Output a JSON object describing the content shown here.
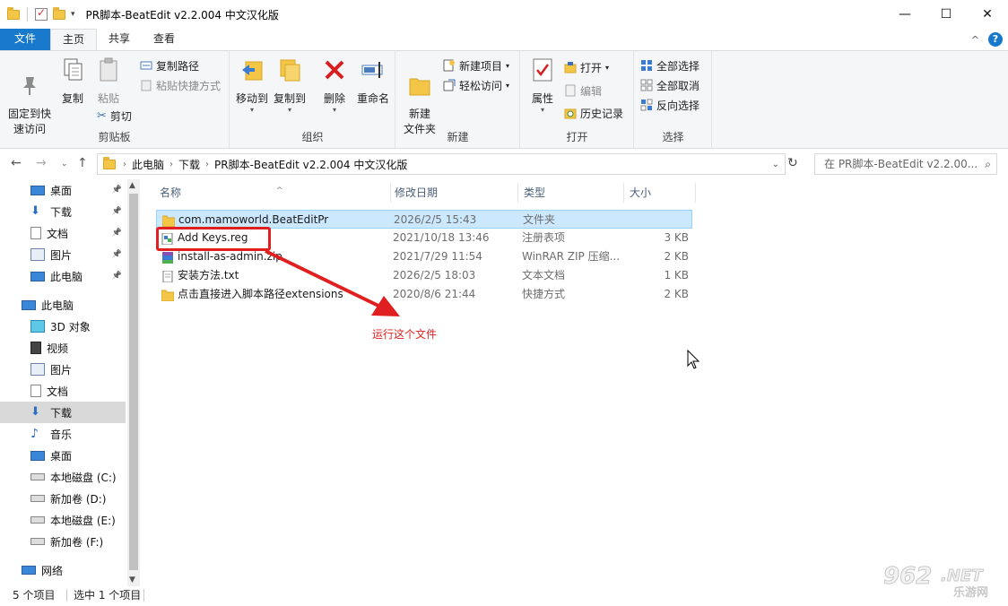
{
  "window": {
    "title": "PR脚本-BeatEdit v2.2.004 中文汉化版",
    "controls": [
      "—",
      "☐",
      "✕"
    ]
  },
  "ribbon_tabs": [
    "文件",
    "主页",
    "共享",
    "查看"
  ],
  "ribbon": {
    "clipboard": {
      "pin": "固定到快\n速访问",
      "copy": "复制",
      "paste": "粘贴",
      "copy_path": "复制路径",
      "paste_shortcut": "粘贴快捷方式",
      "cut": "剪切",
      "label": "剪贴板"
    },
    "organize": {
      "move_to": "移动到",
      "copy_to": "复制到",
      "delete": "删除",
      "rename": "重命名",
      "label": "组织"
    },
    "new": {
      "new_folder": "新建\n文件夹",
      "new_item": "新建项目",
      "easy_access": "轻松访问",
      "label": "新建"
    },
    "open": {
      "properties": "属性",
      "open": "打开",
      "edit": "编辑",
      "history": "历史记录",
      "label": "打开"
    },
    "select": {
      "select_all": "全部选择",
      "select_none": "全部取消",
      "invert": "反向选择",
      "label": "选择"
    }
  },
  "address": {
    "crumbs": [
      "此电脑",
      "下载",
      "PR脚本-BeatEdit v2.2.004 中文汉化版"
    ],
    "search_placeholder": "在 PR脚本-BeatEdit v2.2.00..."
  },
  "nav": [
    {
      "label": "桌面",
      "icon": "desktop-icon",
      "pinned": true
    },
    {
      "label": "下载",
      "icon": "download-icon",
      "pinned": true
    },
    {
      "label": "文档",
      "icon": "document-icon",
      "pinned": true
    },
    {
      "label": "图片",
      "icon": "picture-icon",
      "pinned": true
    },
    {
      "label": "此电脑",
      "icon": "computer-icon",
      "pinned": true
    },
    {
      "label": "此电脑",
      "icon": "computer-icon",
      "pinned": false
    },
    {
      "label": "3D 对象",
      "icon": "3d-objects-icon",
      "pinned": false
    },
    {
      "label": "视频",
      "icon": "video-icon",
      "pinned": false
    },
    {
      "label": "图片",
      "icon": "picture-icon",
      "pinned": false
    },
    {
      "label": "文档",
      "icon": "document-icon",
      "pinned": false
    },
    {
      "label": "下载",
      "icon": "download-icon",
      "pinned": false,
      "selected": true
    },
    {
      "label": "音乐",
      "icon": "music-icon",
      "pinned": false
    },
    {
      "label": "桌面",
      "icon": "desktop-icon",
      "pinned": false
    },
    {
      "label": "本地磁盘 (C:)",
      "icon": "system-drive-icon",
      "pinned": false
    },
    {
      "label": "新加卷 (D:)",
      "icon": "drive-icon",
      "pinned": false
    },
    {
      "label": "本地磁盘 (E:)",
      "icon": "drive-icon",
      "pinned": false
    },
    {
      "label": "新加卷 (F:)",
      "icon": "drive-icon",
      "pinned": false
    },
    {
      "label": "网络",
      "icon": "network-icon",
      "pinned": false
    }
  ],
  "columns": [
    "名称",
    "修改日期",
    "类型",
    "大小"
  ],
  "files": [
    {
      "name": "com.mamoworld.BeatEditPr",
      "date": "2026/2/5 15:43",
      "type": "文件夹",
      "size": "",
      "icon": "folder-icon",
      "selected": true
    },
    {
      "name": "Add Keys.reg",
      "date": "2021/10/18 13:46",
      "type": "注册表项",
      "size": "3 KB",
      "icon": "registry-file-icon"
    },
    {
      "name": "install-as-admin.zip",
      "date": "2021/7/29 11:54",
      "type": "WinRAR ZIP 压缩...",
      "size": "2 KB",
      "icon": "winrar-zip-icon"
    },
    {
      "name": "安装方法.txt",
      "date": "2026/2/5 18:03",
      "type": "文本文档",
      "size": "1 KB",
      "icon": "text-file-icon"
    },
    {
      "name": "点击直接进入脚本路径extensions",
      "date": "2020/8/6 21:44",
      "type": "快捷方式",
      "size": "2 KB",
      "icon": "shortcut-folder-icon"
    }
  ],
  "annotation": "运行这个文件",
  "status": {
    "count": "5 个项目",
    "selected": "选中 1 个项目"
  },
  "watermark": {
    "number": "962",
    "domain": ".NET",
    "sub": "乐游网"
  },
  "colors": {
    "accent": "#1979ca",
    "selection": "#cce8ff",
    "annotation": "#e02020"
  }
}
